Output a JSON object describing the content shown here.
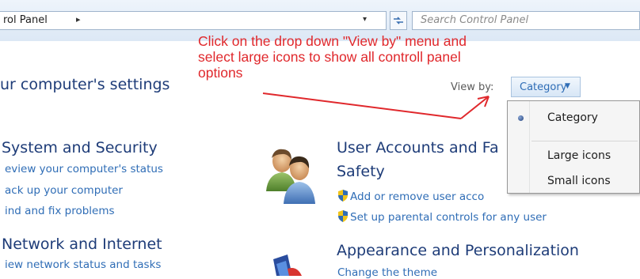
{
  "address": {
    "path_label": "rol Panel",
    "separator": "▸",
    "dropdown_glyph": "▾",
    "refresh_icon": "refresh-arrows-icon"
  },
  "search": {
    "placeholder": "Search Control Panel"
  },
  "annotation": {
    "text": "Click on the drop down \"View by\" menu and\nselect large icons to show all controll panel\noptions",
    "color": "#e0282c"
  },
  "header": {
    "title": "ur computer's settings"
  },
  "view_by": {
    "label": "View by:",
    "selected": "Category",
    "arrow": "▼",
    "options": [
      {
        "label": "Category",
        "checked": true
      },
      {
        "label": "Large icons",
        "checked": false
      },
      {
        "label": "Small icons",
        "checked": false
      }
    ]
  },
  "categories": {
    "system": {
      "title": "System and Security",
      "links": [
        "eview your computer's status",
        "ack up your computer",
        "ind and fix problems"
      ]
    },
    "network": {
      "title": "Network and Internet",
      "links": [
        "iew network status and tasks"
      ]
    },
    "users": {
      "title_line1": "User Accounts and Fa",
      "title_line2": "Safety",
      "links": [
        "Add or remove user acco",
        "Set up parental controls for any user"
      ]
    },
    "appearance": {
      "title": "Appearance and Personalization",
      "links": [
        "Change the theme"
      ]
    }
  },
  "colors": {
    "link_blue": "#2f6db6",
    "title_navy": "#1e3c78",
    "annotation_red": "#e0282c"
  }
}
